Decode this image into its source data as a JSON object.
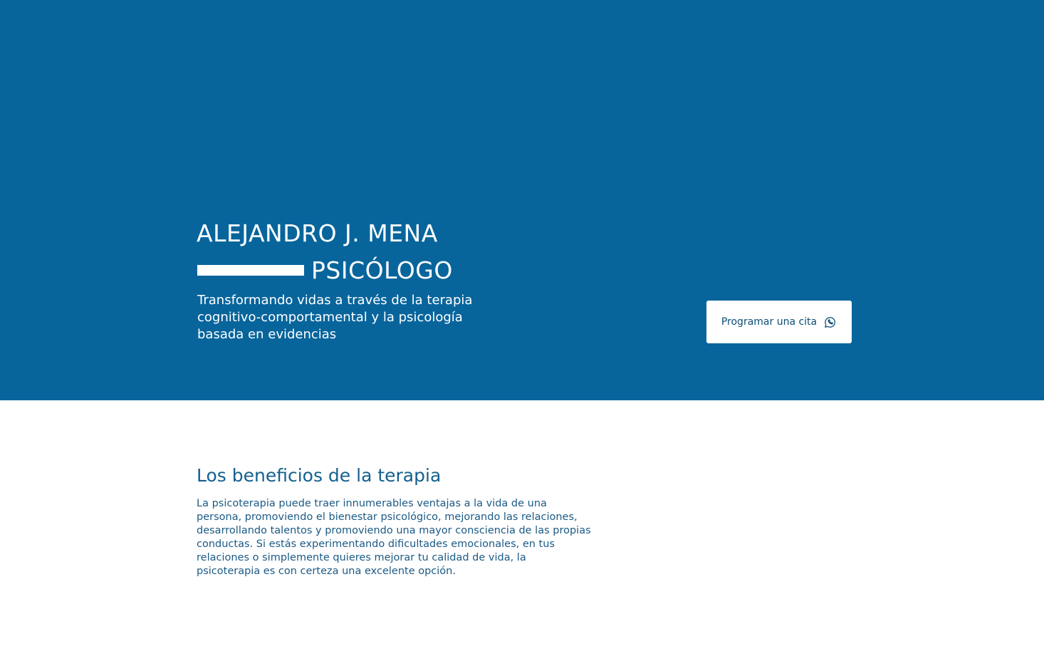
{
  "hero": {
    "name": "ALEJANDRO J. MENA",
    "role": "PSICÓLOGO",
    "tagline": "Transformando vidas a través de la terapia cognitivo-comportamental y la psicología basada en evidencias",
    "cta_label": "Programar una cita",
    "cta_icon": "whatsapp-icon",
    "background_color": "#08659c"
  },
  "benefits": {
    "title": "Los beneficios de la terapia",
    "body": "La psicoterapia puede traer innumerables ventajas a la vida de una persona, promoviendo el bienestar psicológico, mejorando las relaciones, desarrollando talentos y promoviendo una mayor consciencia de las propias conductas. Si estás experimentando dificultades emocionales, en tus relaciones o simplemente quieres mejorar tu calidad de vida, la psicoterapia es con certeza una excelente opción."
  }
}
